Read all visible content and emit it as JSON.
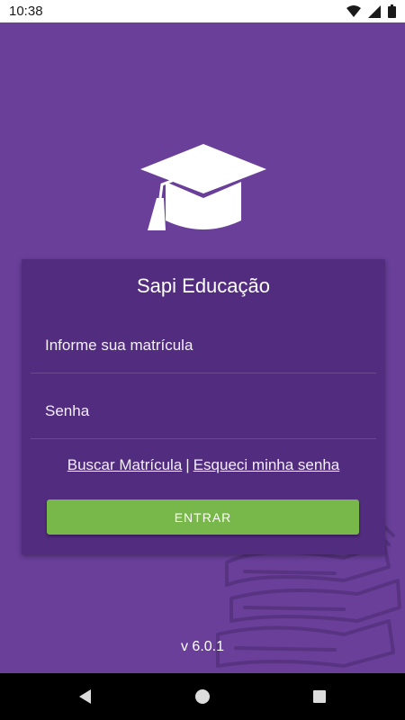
{
  "status_bar": {
    "time": "10:38",
    "icons": [
      "wifi-icon",
      "signal-icon",
      "battery-icon"
    ]
  },
  "login": {
    "title": "Sapi Educação",
    "matricula_placeholder": "Informe sua matrícula",
    "senha_placeholder": "Senha",
    "link_buscar": "Buscar Matrícula",
    "separator": "|",
    "link_esqueci": "Esqueci minha senha",
    "button_entrar": "ENTRAR"
  },
  "footer": {
    "version": "v 6.0.1"
  },
  "nav_bar": {
    "icons": [
      "back-icon",
      "home-icon",
      "recents-icon"
    ]
  },
  "colors": {
    "background": "#693f9a",
    "card": "#522c7f",
    "button": "#78b84a",
    "text": "#ffffff"
  }
}
